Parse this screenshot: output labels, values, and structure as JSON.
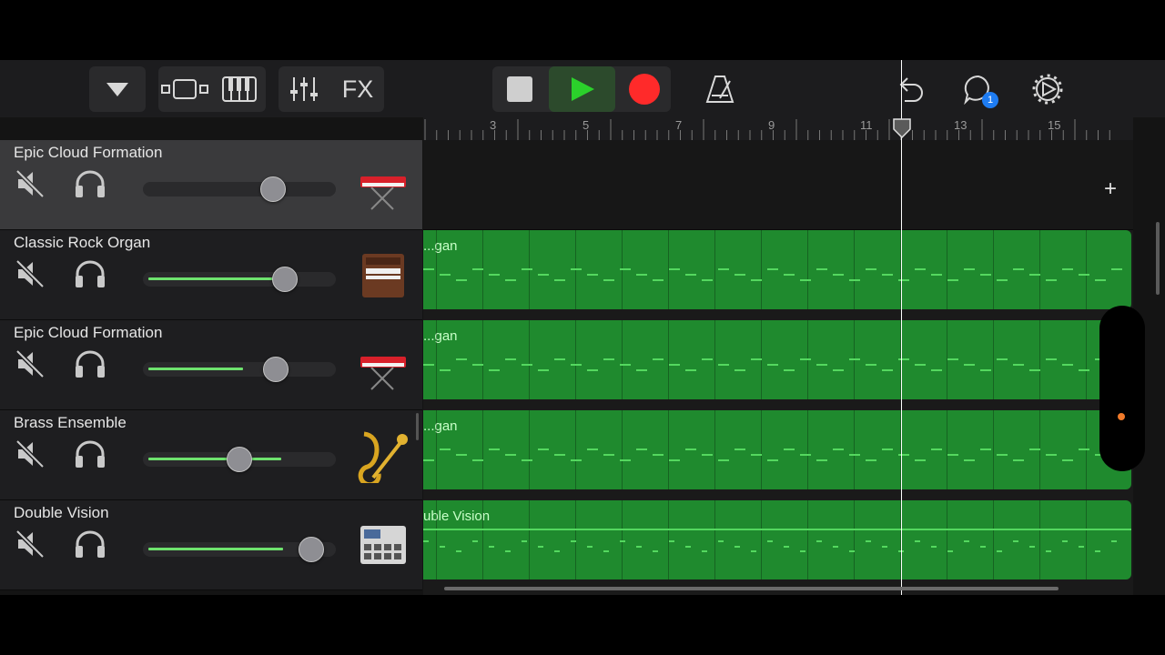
{
  "toolbar": {
    "fx_label": "FX",
    "count_badge": "1",
    "icons": [
      "tracks-dropdown-icon",
      "track-view-icon",
      "keyboard-icon",
      "mixer-icon",
      "stop-icon",
      "play-icon",
      "record-icon",
      "metronome-icon",
      "undo-icon",
      "loop-browser-icon",
      "settings-icon"
    ]
  },
  "ruler": {
    "bars": [
      "3",
      "5",
      "7",
      "9",
      "11",
      "13",
      "15"
    ],
    "add_label": "+"
  },
  "tracks": [
    {
      "name": "Epic Cloud Formation",
      "instrument": "synth-keyboard-icon",
      "volume": 0.7,
      "meter": 0,
      "selected": true,
      "region": ""
    },
    {
      "name": "Classic Rock Organ",
      "instrument": "organ-icon",
      "volume": 0.77,
      "meter": 0.77,
      "selected": false,
      "region": "...gan"
    },
    {
      "name": "Epic Cloud Formation",
      "instrument": "synth-keyboard-icon",
      "volume": 0.72,
      "meter": 0.52,
      "selected": false,
      "region": "...gan"
    },
    {
      "name": "Brass Ensemble",
      "instrument": "brass-icon",
      "volume": 0.5,
      "meter": 0.73,
      "selected": false,
      "region": "...gan"
    },
    {
      "name": "Double Vision",
      "instrument": "beat-machine-icon",
      "volume": 0.93,
      "meter": 0.74,
      "selected": false,
      "region": "uble Vision"
    }
  ],
  "colors": {
    "region": "#1f8a2e",
    "note": "#54d85f",
    "meter": "#6ee36e",
    "record": "#ff2a2a",
    "play": "#2bd12b"
  }
}
